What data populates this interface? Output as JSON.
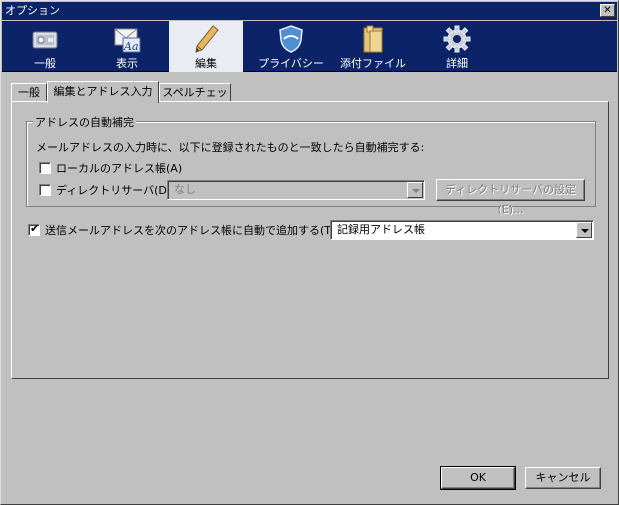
{
  "window": {
    "title": "オプション",
    "close_symbol": "✕"
  },
  "toolbar": {
    "items": [
      {
        "label": "一般",
        "icon": "general-icon"
      },
      {
        "label": "表示",
        "icon": "display-icon"
      },
      {
        "label": "編集",
        "icon": "edit-pencil-icon",
        "selected": true
      },
      {
        "label": "プライバシー",
        "icon": "privacy-shield-icon"
      },
      {
        "label": "添付ファイル",
        "icon": "attachment-folder-icon"
      },
      {
        "label": "詳細",
        "icon": "advanced-gear-icon"
      }
    ]
  },
  "tabs": [
    {
      "label": "一般"
    },
    {
      "label": "編集とアドレス入力",
      "selected": true
    },
    {
      "label": "スペルチェック"
    }
  ],
  "autocomplete": {
    "group_title": "アドレスの自動補完",
    "description": "メールアドレスの入力時に、以下に登録されたものと一致したら自動補完する:",
    "local_addressbook": {
      "label": "ローカルのアドレス帳(A)",
      "checked": false
    },
    "directory_server": {
      "label": "ディレクトリサーバ(D):",
      "checked": false,
      "value": "なし",
      "button": "ディレクトリサーバの設定(E)..."
    }
  },
  "auto_add": {
    "label": "送信メールアドレスを次のアドレス帳に自動で追加する(T):",
    "checked": true,
    "value": "記録用アドレス帳"
  },
  "footer": {
    "ok": "OK",
    "cancel": "キャンセル"
  },
  "colors": {
    "titlebar": "#0a246a",
    "toolbar": "#0d2368",
    "selected_tool": "#e9ecf2",
    "face": "#c0c0c0"
  }
}
